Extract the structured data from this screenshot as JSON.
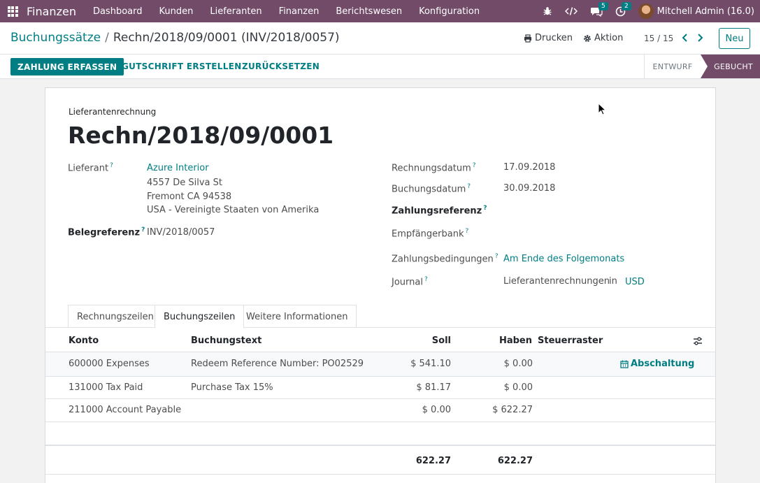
{
  "navbar": {
    "brand": "Finanzen",
    "menu": [
      "Dashboard",
      "Kunden",
      "Lieferanten",
      "Finanzen",
      "Berichtswesen",
      "Konfiguration"
    ],
    "messages_count": "5",
    "activities_count": "2",
    "user": "Mitchell Admin (16.0)"
  },
  "control_panel": {
    "breadcrumb_parent": "Buchungssätze",
    "breadcrumb_sep": "/",
    "breadcrumb_current": "Rechn/2018/09/0001 (INV/2018/0057)",
    "print_label": "Drucken",
    "action_label": "Aktion",
    "pager": "15 / 15",
    "new_label": "Neu"
  },
  "statusbar": {
    "register_payment": "ZAHLUNG ERFASSEN",
    "credit_note": "GUTSCHRIFT ERSTELLEN",
    "reset": "ZURÜCKSETZEN",
    "states": [
      "ENTWURF",
      "GEBUCHT"
    ],
    "active_state": "GEBUCHT"
  },
  "form": {
    "doc_type": "Lieferantenrechnung",
    "doc_name": "Rechn/2018/09/0001",
    "vendor_label": "Lieferant",
    "vendor_name": "Azure Interior",
    "vendor_address": [
      "4557 De Silva St",
      "Fremont CA 94538",
      "USA - Vereinigte Staaten von Amerika"
    ],
    "bill_ref_label": "Belegreferenz",
    "bill_ref": "INV/2018/0057",
    "invoice_date_label": "Rechnungsdatum",
    "invoice_date": "17.09.2018",
    "accounting_date_label": "Buchungsdatum",
    "accounting_date": "30.09.2018",
    "payment_ref_label": "Zahlungsreferenz",
    "recipient_bank_label": "Empfängerbank",
    "payment_terms_label": "Zahlungsbedingungen",
    "payment_terms": "Am Ende des Folgemonats",
    "journal_label": "Journal",
    "journal": "Lieferantenrechnungen",
    "journal_in": "in",
    "currency": "USD",
    "help_mark": "?"
  },
  "tabs": [
    "Rechnungszeilen",
    "Buchungszeilen",
    "Weitere Informationen"
  ],
  "active_tab": "Buchungszeilen",
  "table": {
    "headers": [
      "Konto",
      "Buchungstext",
      "Soll",
      "Haben",
      "Steuerraster"
    ],
    "rows": [
      {
        "account": "600000 Expenses",
        "label": "Redeem Reference Number: PO02529",
        "debit": "$ 541.10",
        "credit": "$ 0.00",
        "tax_grid": "",
        "action": "Abschaltung"
      },
      {
        "account": "131000 Tax Paid",
        "label": "Purchase Tax 15%",
        "debit": "$ 81.17",
        "credit": "$ 0.00",
        "tax_grid": "",
        "action": ""
      },
      {
        "account": "211000 Account Payable",
        "label": "",
        "debit": "$ 0.00",
        "credit": "$ 622.27",
        "tax_grid": "",
        "action": ""
      }
    ],
    "total_debit": "622.27",
    "total_credit": "622.27"
  },
  "colors": {
    "brand": "#714b67",
    "accent": "#017e84"
  }
}
